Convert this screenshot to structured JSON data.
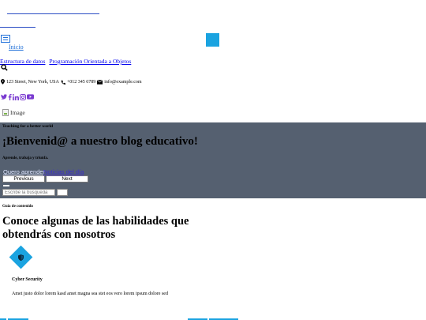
{
  "nav": {
    "home_label": "Inicio",
    "links": [
      "Estructura de datos",
      "Programación Orientada a Objetos"
    ]
  },
  "contact": {
    "address": "123 Street, New York, USA",
    "phone": "+012 345 6789",
    "email": "info@example.com"
  },
  "social_icons": [
    "twitter-icon",
    "facebook-icon",
    "linkedin-icon",
    "instagram-icon",
    "youtube-icon"
  ],
  "image_alt": "Image",
  "hero": {
    "subtitle": "Teaching for a better world",
    "title": "¡Bienvenid@ a nuestro blog educativo!",
    "tagline": "Aprende, trabaja y triunfa.",
    "primary_button": "Quero aprender",
    "secondary_button": "Noticias del día",
    "prev_label": "Previous",
    "next_label": "Next"
  },
  "search": {
    "placeholder": "Escribe la búsqueda"
  },
  "content": {
    "toc_label": "Guía de contenido",
    "section_title": "Conoce algunas de las habilidades que obtendrás con nosotros",
    "skill": {
      "icon": "shield-icon",
      "title": "Cyber Security",
      "description": "Amet justo dolor lorem kasd amet magna sea stet eos vero lorem ipsum dolore sed"
    }
  },
  "colors": {
    "accent": "#1aa3e0",
    "hero_bg": "#556070",
    "link": "#0000ee"
  }
}
